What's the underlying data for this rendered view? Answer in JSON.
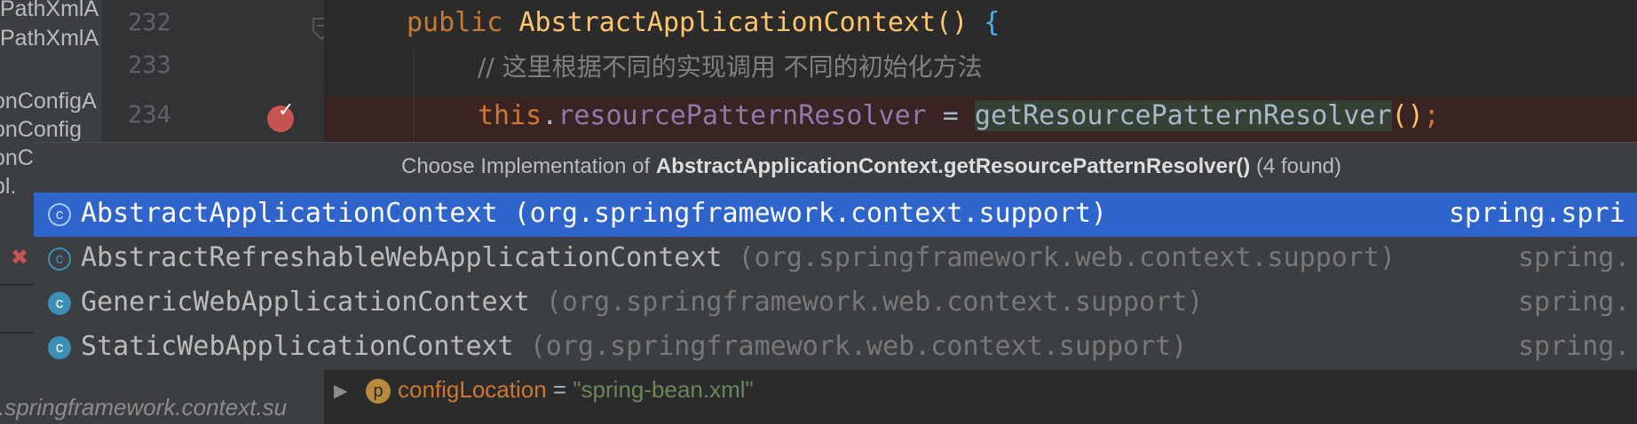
{
  "structure_panel": {
    "items": [
      "PathXmlA",
      "PathXmlA",
      "onConfigA",
      "onConfig",
      "onC",
      "pl."
    ],
    "package_path": ".springframework.context.su"
  },
  "gutter": {
    "line_numbers": [
      "232",
      "233",
      "234"
    ]
  },
  "code": {
    "line232": {
      "keyword": "public",
      "constructor": "AbstractApplicationContext",
      "parens": "()",
      "brace": "{"
    },
    "line233": {
      "comment": "// 这里根据不同的实现调用 不同的初始化方法"
    },
    "line234": {
      "this_kw": "this",
      "dot": ".",
      "field": "resourcePatternResolver",
      "assign": " = ",
      "call": "getResourcePatternResolver",
      "call_parens": "()",
      "semicolon": ";"
    }
  },
  "popup": {
    "title_prefix": "Choose Implementation of ",
    "title_method": "AbstractApplicationContext.getResourcePatternResolver()",
    "title_count": " (4 found)",
    "implementations": [
      {
        "name": "AbstractApplicationContext",
        "package": " (org.springframework.context.support)",
        "module": "spring.spri",
        "icon": "abstract-class-icon",
        "selected": true
      },
      {
        "name": "AbstractRefreshableWebApplicationContext",
        "package": " (org.springframework.web.context.support)",
        "module": "spring.",
        "icon": "abstract-class-icon",
        "selected": false
      },
      {
        "name": "GenericWebApplicationContext",
        "package": " (org.springframework.web.context.support)",
        "module": "spring.",
        "icon": "class-icon",
        "selected": false
      },
      {
        "name": "StaticWebApplicationContext",
        "package": " (org.springframework.web.context.support)",
        "module": "spring.",
        "icon": "class-icon",
        "selected": false
      }
    ]
  },
  "debug": {
    "icon_letter": "p",
    "var_name": "configLocation",
    "eq": " = ",
    "value": "\"spring-bean.xml\""
  },
  "colors": {
    "selection": "#2f65ca",
    "keyword": "#cc7832",
    "method": "#ffc66d",
    "field": "#9876aa",
    "string": "#6a8759",
    "breakpoint": "#c75450"
  }
}
